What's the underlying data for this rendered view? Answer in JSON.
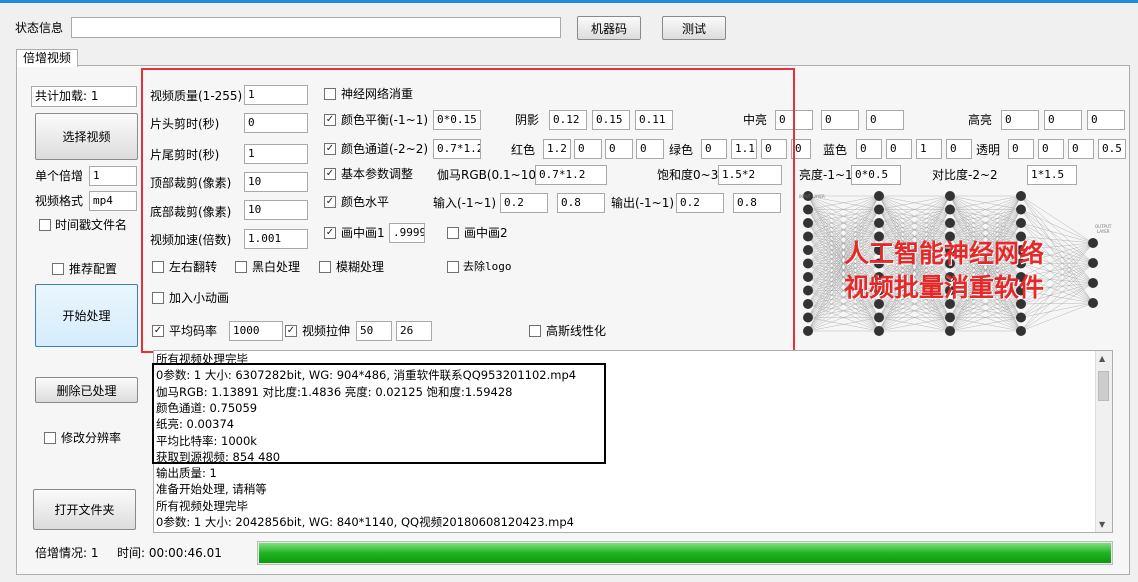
{
  "top": {
    "status_label": "状态信息",
    "status_value": "",
    "machine_code_btn": "机器码",
    "test_btn": "测试"
  },
  "tab_label": "倍增视频",
  "left": {
    "total_load_label": "共计加载: 1",
    "select_video_btn": "选择视频",
    "single_multiply_label": "单个倍增",
    "single_multiply_value": "1",
    "video_format_label": "视频格式",
    "video_format_value": "mp4",
    "timestamp_filename_label": "时间戳文件名",
    "recommend_config_label": "推荐配置",
    "start_btn": "开始处理",
    "delete_processed_btn": "删除已处理",
    "change_resolution_label": "修改分辨率",
    "open_folder_btn": "打开文件夹"
  },
  "params": {
    "quality_label": "视频质量(1-255)",
    "quality_value": "1",
    "head_cut_label": "片头剪时(秒)",
    "head_cut_value": "0",
    "tail_cut_label": "片尾剪时(秒)",
    "tail_cut_value": "1",
    "top_crop_label": "顶部裁剪(像素)",
    "top_crop_value": "10",
    "bottom_crop_label": "底部裁剪(像素)",
    "bottom_crop_value": "10",
    "speed_label": "视频加速(倍数)",
    "speed_value": "1.001",
    "neural_label": "神经网络消重",
    "color_balance_label": "颜色平衡(-1~1)",
    "color_balance_value": "0*0.15",
    "shadow_label": "阴影",
    "shadow_values": [
      "0.12",
      "0.15",
      "0.11"
    ],
    "midtone_label": "中亮",
    "midtone_values": [
      "0",
      "0",
      "0"
    ],
    "highlight_label": "高亮",
    "highlight_values": [
      "0",
      "0",
      "0"
    ],
    "color_channel_label": "颜色通道(-2~2)",
    "color_channel_value": "0.7*1.2",
    "red_label": "红色",
    "red_values": [
      "1.2",
      "0",
      "0",
      "0"
    ],
    "green_label": "绿色",
    "green_values": [
      "0",
      "1.1",
      "0",
      "0"
    ],
    "blue_label": "蓝色",
    "blue_values": [
      "0",
      "0",
      "1",
      "0"
    ],
    "alpha_label": "透明",
    "alpha_values": [
      "0",
      "0",
      "0",
      "0.5"
    ],
    "basic_adjust_label": "基本参数调整",
    "gamma_label": "伽马RGB(0.1~10)",
    "gamma_value": "0.7*1.2",
    "saturation_label": "饱和度0~3",
    "saturation_value": "1.5*2",
    "brightness_label": "亮度-1~1",
    "brightness_value": "0*0.5",
    "contrast_label": "对比度-2~2",
    "contrast_value": "1*1.5",
    "color_level_label": "颜色水平",
    "input_label": "输入(-1~1)",
    "input_values": [
      "0.2",
      "0.8"
    ],
    "output_label": "输出(-1~1)",
    "output_values": [
      "0.2",
      "0.8"
    ],
    "pip1_label": "画中画1",
    "pip1_value": ".9999",
    "pip2_label": "画中画2",
    "flip_label": "左右翻转",
    "bw_label": "黑白处理",
    "blur_label": "模糊处理",
    "logo_label": "去除logo",
    "anim_label": "加入小动画",
    "avg_bitrate_label": "平均码率",
    "avg_bitrate_value": "1000",
    "stretch_label": "视频拉伸",
    "stretch_values": [
      "50",
      "26"
    ],
    "gauss_label": "高斯线性化"
  },
  "overlay": {
    "line1": "人工智能神经网络",
    "line2": "视频批量消重软件"
  },
  "log_lines": [
    "所有视频处理完毕",
    "0参数: 1  大小: 6307282bit, WG: 904*486,  消重软件联系QQ953201102.mp4",
    "伽马RGB: 1.13891 对比度:1.4836 亮度: 0.02125 饱和度:1.59428",
    "颜色通道: 0.75059",
    "纸亮: 0.00374",
    "平均比特率: 1000k",
    "获取到源视频: 854  480",
    "输出质量: 1",
    "准备开始处理, 请稍等",
    "所有视频处理完毕",
    "0参数: 1  大小: 2042856bit, WG: 840*1140,  QQ视频20180608120423.mp4"
  ],
  "bottom": {
    "multiply_status_label": "倍增情况: 1",
    "time_label": "时间: 00:00:46.01",
    "progress": 1.0
  },
  "colors": {
    "accent": "#1e8be0",
    "highlight": "#e5323a",
    "progress": "#22b322"
  }
}
